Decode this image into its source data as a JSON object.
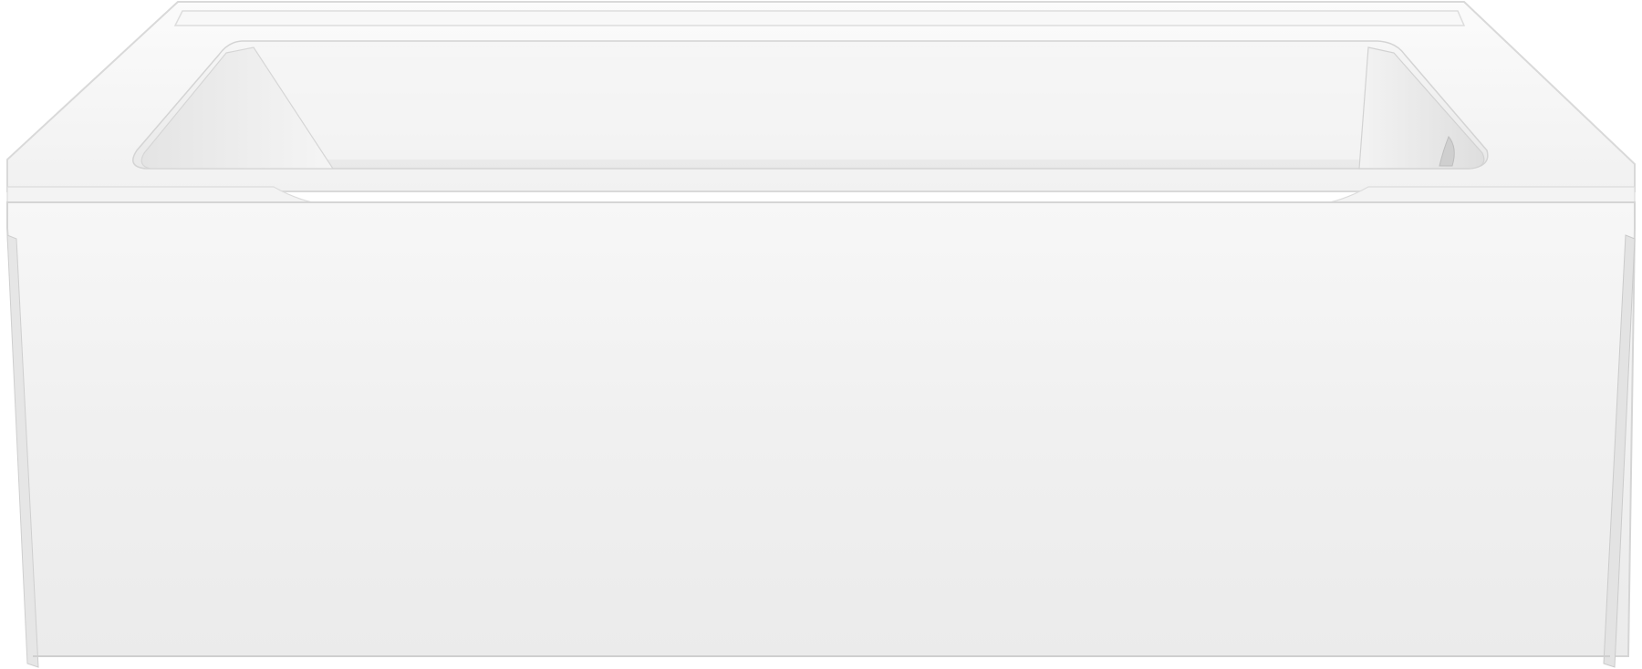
{
  "image": {
    "subject": "bathtub-product-photo",
    "background_color": "#ffffff",
    "tub_color": "#f4f4f4",
    "apron_color": "#f1f1f1",
    "basin_color": "#ececec",
    "edge_color": "#d6d6d6",
    "shadow_color": "#c9c9c9",
    "drain_side": "right"
  }
}
